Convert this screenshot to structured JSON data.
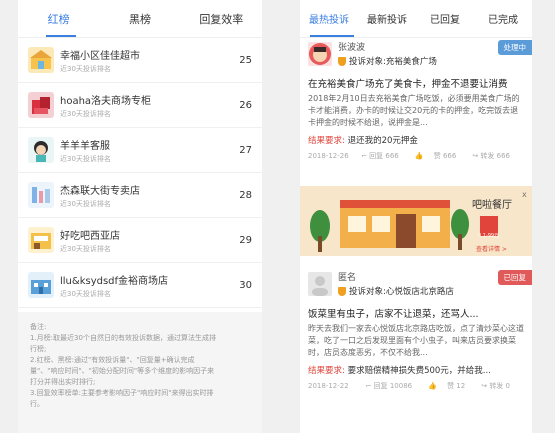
{
  "left": {
    "tabs": [
      {
        "label": "红榜"
      },
      {
        "label": "黑榜"
      },
      {
        "label": "回复效率"
      }
    ],
    "ranking": [
      {
        "name": "幸福小区佳佳超市",
        "sub": "近30天投诉排名",
        "count": "25",
        "logo_color": "#f6c44c"
      },
      {
        "name": "hoaha洛夫商场专柜",
        "sub": "近30天投诉排名",
        "count": "26",
        "logo_color": "#d9303f"
      },
      {
        "name": "羊羊羊客服",
        "sub": "近30天投诉排名",
        "count": "27",
        "logo_color": "#2c2c2c"
      },
      {
        "name": "杰森联大街专卖店",
        "sub": "近30天投诉排名",
        "count": "28",
        "logo_color": "#7fb2e6"
      },
      {
        "name": "好吃吧西亚店",
        "sub": "近30天投诉排名",
        "count": "29",
        "logo_color": "#f3c04a"
      },
      {
        "name": "llu&ksydsdf金裕商场店",
        "sub": "近30天投诉排名",
        "count": "30",
        "logo_color": "#5aa0d8"
      }
    ],
    "notes": [
      "备注:",
      "1.月榜:取最近30个自然日的有效投诉数据，通过算法生成排",
      "行榜;",
      "2.红榜、黑榜:通过\"有效投诉量\"、\"回复量+确认完成",
      "量\"、\"响应时间\"、\"初始分配时间\"等多个维度的影响因子来",
      "打分并得出实时排行;",
      "3.回复效率榜单:主要参考影响因子\"响应时间\"来得出实时排",
      "行。"
    ]
  },
  "right": {
    "tabs": [
      {
        "label": "最热投诉"
      },
      {
        "label": "最新投诉"
      },
      {
        "label": "已回复"
      },
      {
        "label": "已完成"
      }
    ],
    "cards": [
      {
        "user": "张波波",
        "target_prefix": "投诉对象:",
        "target": "充裕美食广场",
        "badge": "处理中",
        "badge_color": "#5b9bd8",
        "title": "在充裕美食广场充了美食卡，押金不退要让消费",
        "body": "2018年2月10日去充裕美食广场吃饭，必须要用美食广场的卡才能消费，办卡的时候让交20元的卡的押金，吃完饭去退卡押金的时候不给退，说押金是...",
        "demand_label": "结果要求:",
        "demand": "退还我的20元押金",
        "date": "2018-12-26",
        "replies": "回复 666",
        "likes": "赞 666",
        "shares": "转发 666"
      },
      {
        "user": "匿名",
        "target_prefix": "投诉对象:",
        "target": "心悦饭店北京路店",
        "badge": "已回复",
        "badge_color": "#e05a5a",
        "title": "饭菜里有虫子，店家不让退菜，还骂人...",
        "body": "昨天去我们一家去心悦饭店北京路店吃饭，点了清炒菜心这道菜，吃了一口之后发现里面有个小虫子，叫来店员要求换菜时，店员态度恶劣，不仅不给我...",
        "demand_label": "结果要求:",
        "demand": "要求赔偿精神损失费500元，并给我...",
        "date": "2018-12-22",
        "replies": "回复 10086",
        "likes": "赞 12",
        "shares": "转发 0"
      }
    ],
    "ad": {
      "title": "吧啦餐厅",
      "price": "0.1-99元",
      "link": "查看详情 >",
      "close": "x"
    }
  }
}
